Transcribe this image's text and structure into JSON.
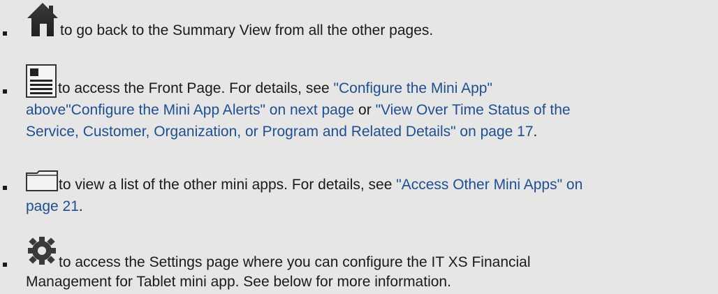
{
  "items": [
    {
      "icon": "home-icon",
      "text_after_icon": " to go back to the Summary View from all the other pages."
    },
    {
      "icon": "front-page-icon",
      "text_before": " to access the Front Page. For details, see ",
      "link1": "\"Configure the Mini App\"",
      "link2": "above\"Configure the Mini App Alerts\" on next page",
      "or": " or ",
      "link3a": "\"View Over Time Status of the",
      "link3b": "Service, Customer, Organization, or Program and Related Details\" on page 17",
      "period": "."
    },
    {
      "icon": "folder-icon",
      "text_before": " to view a list of the other mini apps. For details, see ",
      "link_a": "\"Access Other Mini Apps\" on",
      "link_b": "page 21",
      "period": "."
    },
    {
      "icon": "gear-icon",
      "line1": " to access the Settings page where you can configure the IT XS Financial",
      "line2": "Management for Tablet mini app. See below for more information."
    }
  ]
}
